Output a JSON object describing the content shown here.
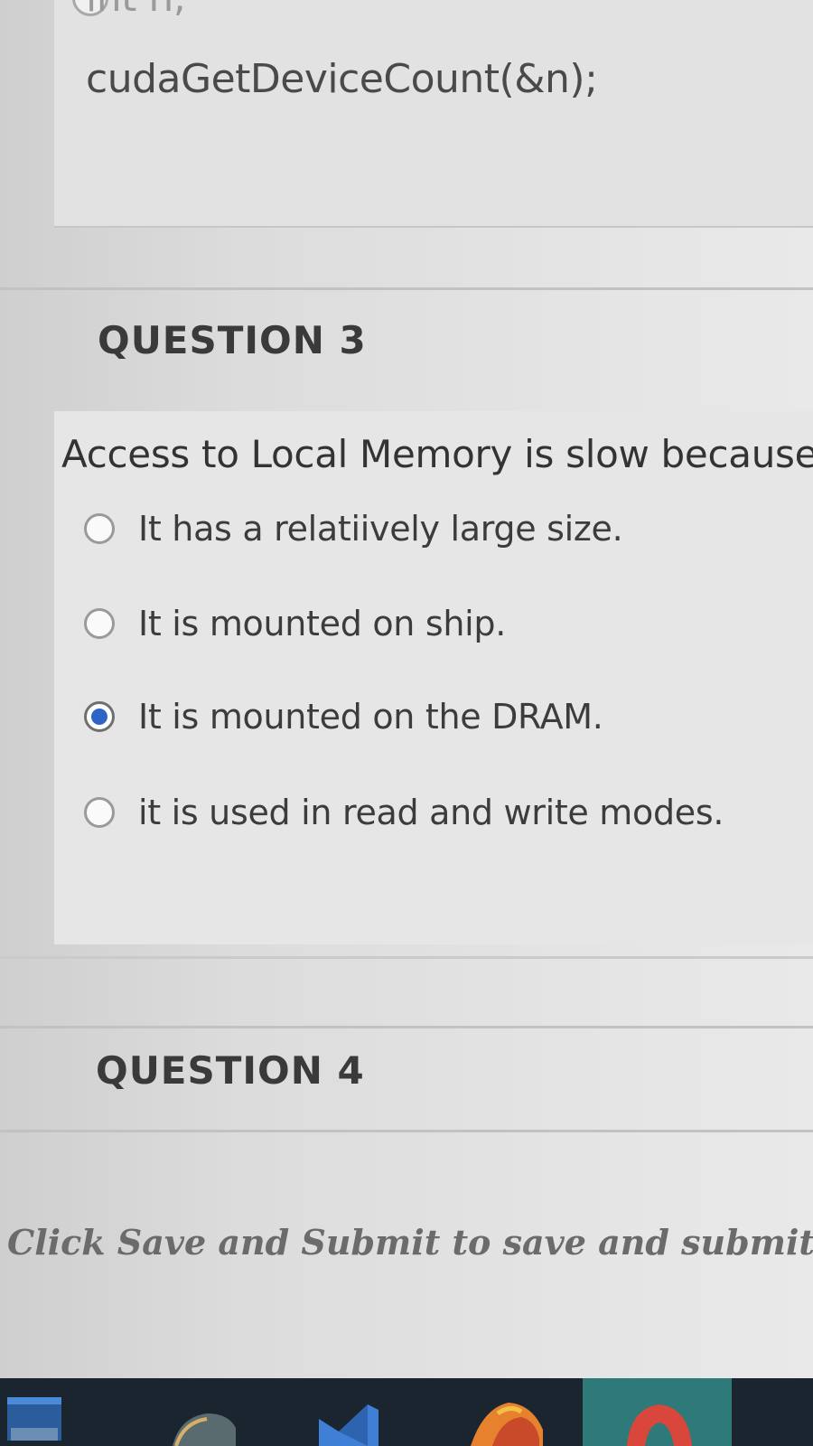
{
  "previous_question": {
    "code_lines": [
      "int n;",
      "cudaGetDeviceCount(&n);"
    ]
  },
  "question3": {
    "title": "QUESTION 3",
    "prompt": "Access to Local Memory is slow because",
    "options": [
      {
        "label": "It has a relatiively large size.",
        "selected": false
      },
      {
        "label": "It is mounted on ship.",
        "selected": false
      },
      {
        "label": "It is mounted on the DRAM.",
        "selected": true
      },
      {
        "label": "it is used in read and write modes.",
        "selected": false
      }
    ]
  },
  "question4": {
    "title": "QUESTION 4"
  },
  "footer": {
    "instruction": "Click Save and Submit to save and submit."
  },
  "taskbar": {
    "icons": [
      "file-explorer-icon",
      "edge-browser-icon",
      "visual-studio-icon",
      "firefox-icon",
      "chrome-icon"
    ]
  },
  "colors": {
    "selected_radio": "#2f64c7",
    "taskbar": "#1a2530"
  }
}
